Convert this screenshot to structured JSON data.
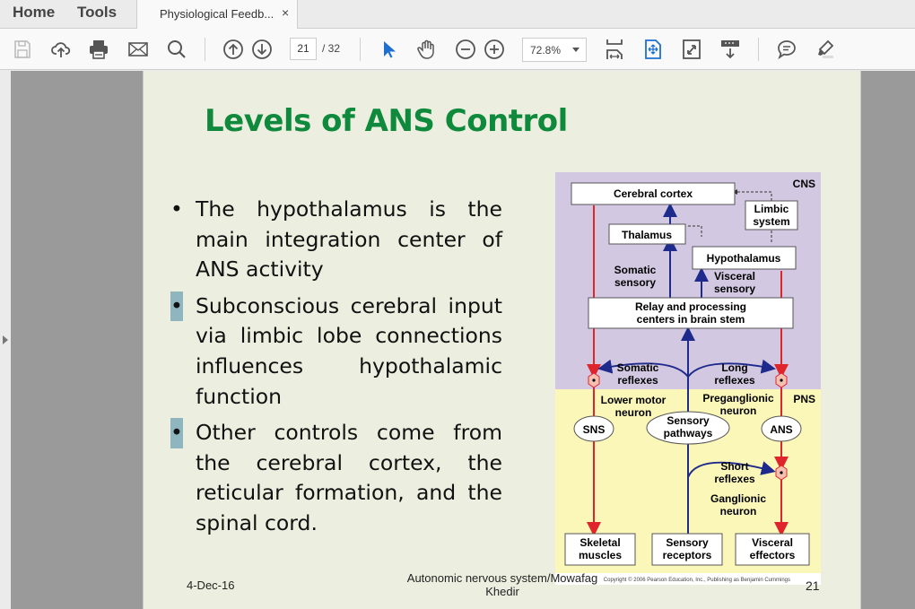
{
  "app": {
    "nav": {
      "home": "Home",
      "tools": "Tools"
    },
    "tab": {
      "title": "Physiological Feedb...",
      "close": "×"
    }
  },
  "toolbar": {
    "icons": [
      "save-icon",
      "cloud-upload-icon",
      "print-icon",
      "email-icon",
      "search-icon",
      "page-up-icon",
      "page-down-icon",
      "select-cursor-icon",
      "hand-tool-icon",
      "zoom-out-icon",
      "zoom-in-icon",
      "fit-width-icon",
      "fit-page-icon",
      "full-screen-icon",
      "read-mode-icon",
      "comment-icon",
      "highlight-icon"
    ],
    "page_current": "21",
    "page_total": "/ 32",
    "zoom": "72.8%"
  },
  "slide": {
    "title": "Levels of ANS Control",
    "bullets": [
      "The hypothalamus is the main integration center of ANS activity",
      "Subconscious cerebral input via limbic lobe connections influences hypothalamic function",
      "Other controls come from the cerebral cortex, the reticular formation, and the spinal cord."
    ],
    "footer": {
      "date": "4-Dec-16",
      "center": "Autonomic nervous system/Mowafag Khedir",
      "page": "21"
    }
  },
  "diagram": {
    "region_labels": {
      "cns": "CNS",
      "pns": "PNS"
    },
    "boxes": {
      "cerebral_cortex": "Cerebral cortex",
      "limbic": [
        "Limbic",
        "system"
      ],
      "thalamus": "Thalamus",
      "hypothalamus": "Hypothalamus",
      "relay": [
        "Relay and processing",
        "centers in brain stem"
      ],
      "skeletal": [
        "Skeletal",
        "muscles"
      ],
      "sensory_receptors": [
        "Sensory",
        "receptors"
      ],
      "visceral_effectors": [
        "Visceral",
        "effectors"
      ]
    },
    "labels": {
      "somatic_sensory": [
        "Somatic",
        "sensory"
      ],
      "visceral_sensory": [
        "Visceral",
        "sensory"
      ],
      "somatic_reflexes": [
        "Somatic",
        "reflexes"
      ],
      "long_reflexes": [
        "Long",
        "reflexes"
      ],
      "lower_motor": [
        "Lower motor",
        "neuron"
      ],
      "preganglionic": [
        "Preganglionic",
        "neuron"
      ],
      "short_reflexes": [
        "Short",
        "reflexes"
      ],
      "ganglionic": [
        "Ganglionic",
        "neuron"
      ]
    },
    "ovals": {
      "sns": "SNS",
      "ans": "ANS",
      "sensory": [
        "Sensory",
        "pathways"
      ]
    },
    "copyright": "Copyright © 2006 Pearson Education, Inc., Publishing as Benjamin Cummings",
    "colors": {
      "cns_bg": "#d2c8e2",
      "pns_bg": "#fbf7b8",
      "motor": "#e0242c",
      "sensory": "#1e2a8c"
    }
  }
}
